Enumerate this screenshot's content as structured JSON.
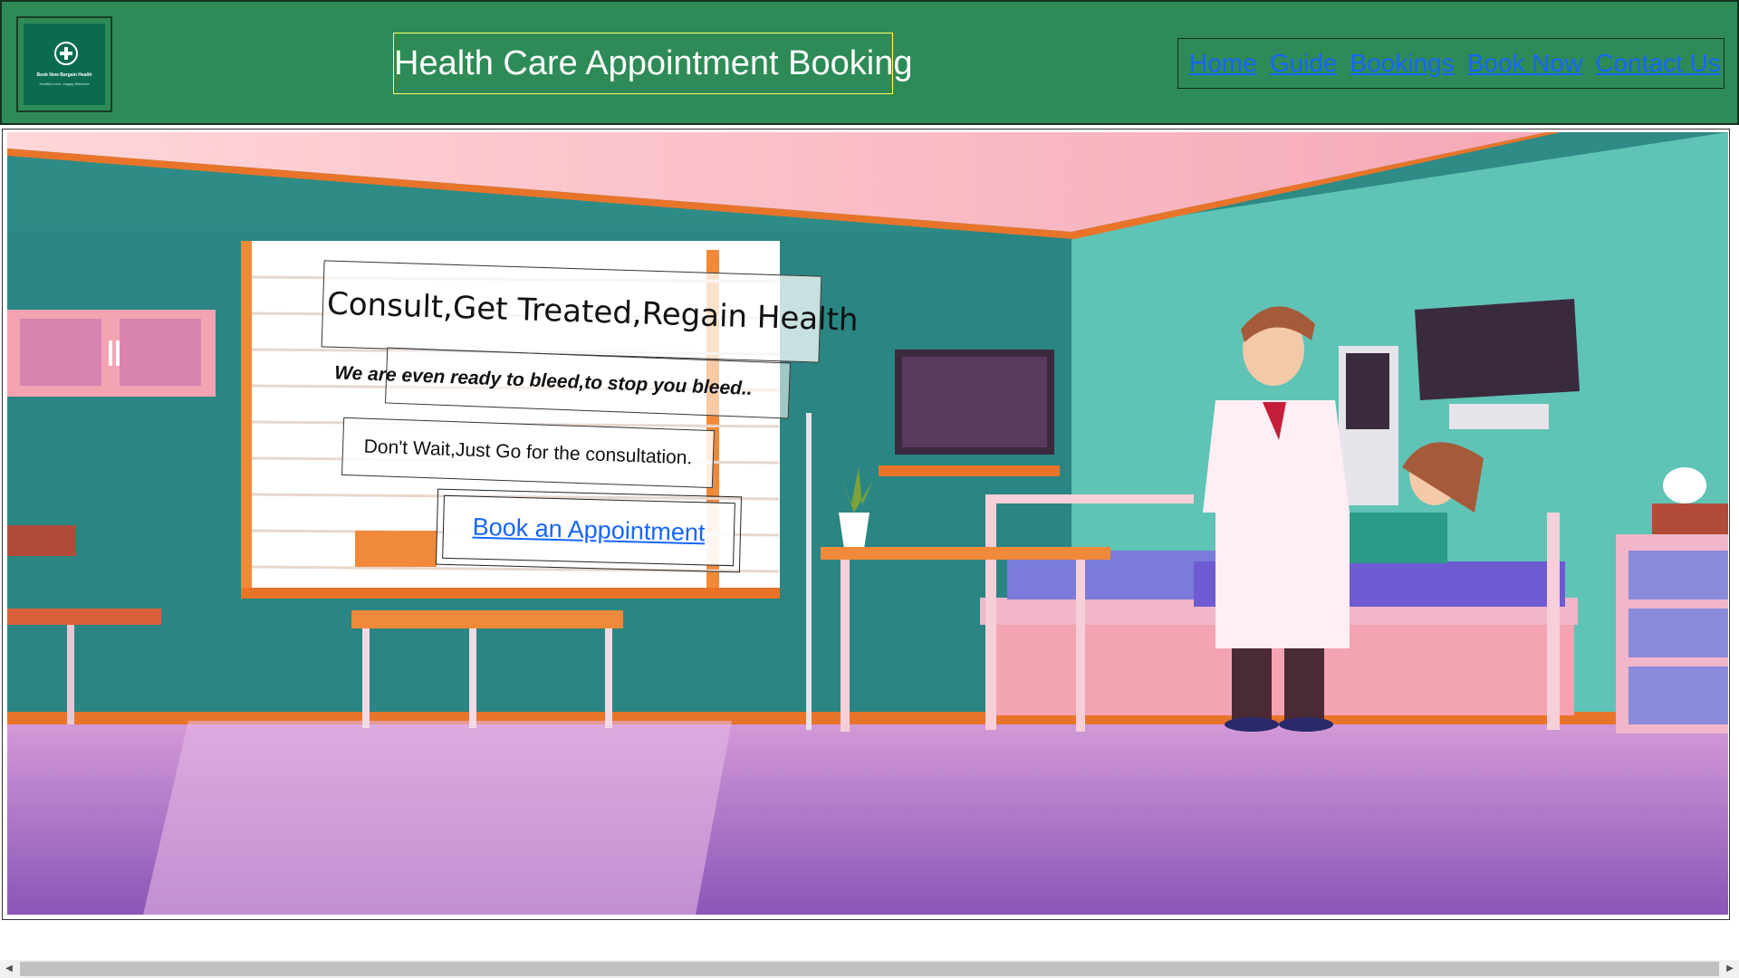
{
  "header": {
    "logo": {
      "name": "Book Now Bargain Health",
      "tagline": "Healthy Lives. Happy Wellness",
      "icon": "medical-cross-icon"
    },
    "title": "Health Care Appointment Booking",
    "nav": [
      "Home",
      "Guide",
      "Bookings",
      "Book Now",
      "Contact Us"
    ]
  },
  "hero": {
    "tagline1": "Consult,Get Treated,Regain Health",
    "tagline2": "We are even ready to bleed,to stop you bleed..",
    "tagline3": "Don't Wait,Just Go for the consultation.",
    "cta": "Book an Appointment"
  },
  "colors": {
    "header_bg": "#2e8b57",
    "link": "#1565ff",
    "title_border": "#ffff66"
  }
}
